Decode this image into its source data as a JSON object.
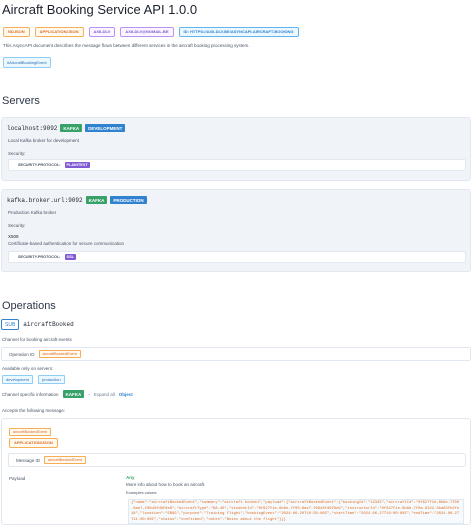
{
  "header": {
    "title": "Aircraft Booking Service API 1.0.0",
    "badges": [
      "NDJSON",
      "APPLICATION/JSON",
      "AXILDLV",
      "AXILDLV@NOMAIL.BE",
      "ID: HTTPS://AXILDLV.BE/ASYNCAPI-AIRCRAFT-BOOKING"
    ],
    "description": "This AsyncAPI document describes the message flows between different services in the aircraft booking processing system.",
    "tag": "#AircraftBookingEvent"
  },
  "servers": {
    "heading": "Servers",
    "items": [
      {
        "url": "localhost:9092",
        "protocol": "KAFKA",
        "env": "DEVELOPMENT",
        "description": "Local Kafka broker for development",
        "security_label": "Security:",
        "sec_key": "SECURITY.PROTOCOL:",
        "sec_value": "PLAINTEXT"
      },
      {
        "url": "kafka.broker.url:9092",
        "protocol": "KAFKA",
        "env": "PRODUCTION",
        "description": "Production Kafka broker",
        "security_label": "Security:",
        "auth_name": "X509",
        "auth_desc": "Certificate-based authentication for secure communication",
        "sec_key": "SECURITY.PROTOCOL:",
        "sec_value": "SSL"
      }
    ]
  },
  "operations": {
    "heading": "Operations",
    "sub_badge": "SUB",
    "channel": "aircraftBooked",
    "channel_desc": "Channel for booking aircraft events",
    "operation_id_label": "Operation ID",
    "operation_id": "aircraftBookedEvent",
    "available_label": "Available only on servers:",
    "servers": [
      "development",
      "production"
    ],
    "channel_info_label": "Channel specific information",
    "channel_info_badge": "KAFKA",
    "expand_all": "Expand all",
    "object_label": "Object",
    "accepts_label": "Accepts the following message:",
    "message": {
      "name_chip": "aircraftBookedEvent",
      "content_type": "APPLICATION/JSON",
      "message_id_label": "Message ID",
      "message_id": "aircraftBookedEvent",
      "payload_label": "Payload",
      "payload_type": "Any",
      "payload_desc": "More info about how to book an aircraft.",
      "examples_label": "Examples values:",
      "example_json": "{\"name\":\"aircraftBookedEvent\",\"summary\":\"aircraft booked\",\"payload\":{\"aircraftBookedEvent\":{\"bookingId\":\"12345\",\"aircraftId\":\"0f627f1e-8b6e-7f00-8ae7-f96d3fd9f8e6\",\"aircraftType\":\"DA-40\",\"studentId\":\"0f627f1e-8b6e-7f00-8ae7-f96d3fd9f8e6\",\"instructorId\":\"0f627f1e-8b6e-7f0a-9322-3ba63fb3fe18\",\"location\":\"EBGG\",\"purpose\":\"Training Flight\",\"bookingEvent\":\"2024-06-20T10:30:00Z\",\"startTime\":\"2024-06-27T10:00:00Z\",\"endTime\":\"2024-06-27T11:00:00Z\",\"status\":\"confirmed\",\"notes\":\"Notes about the flight\"}}}"
    }
  }
}
